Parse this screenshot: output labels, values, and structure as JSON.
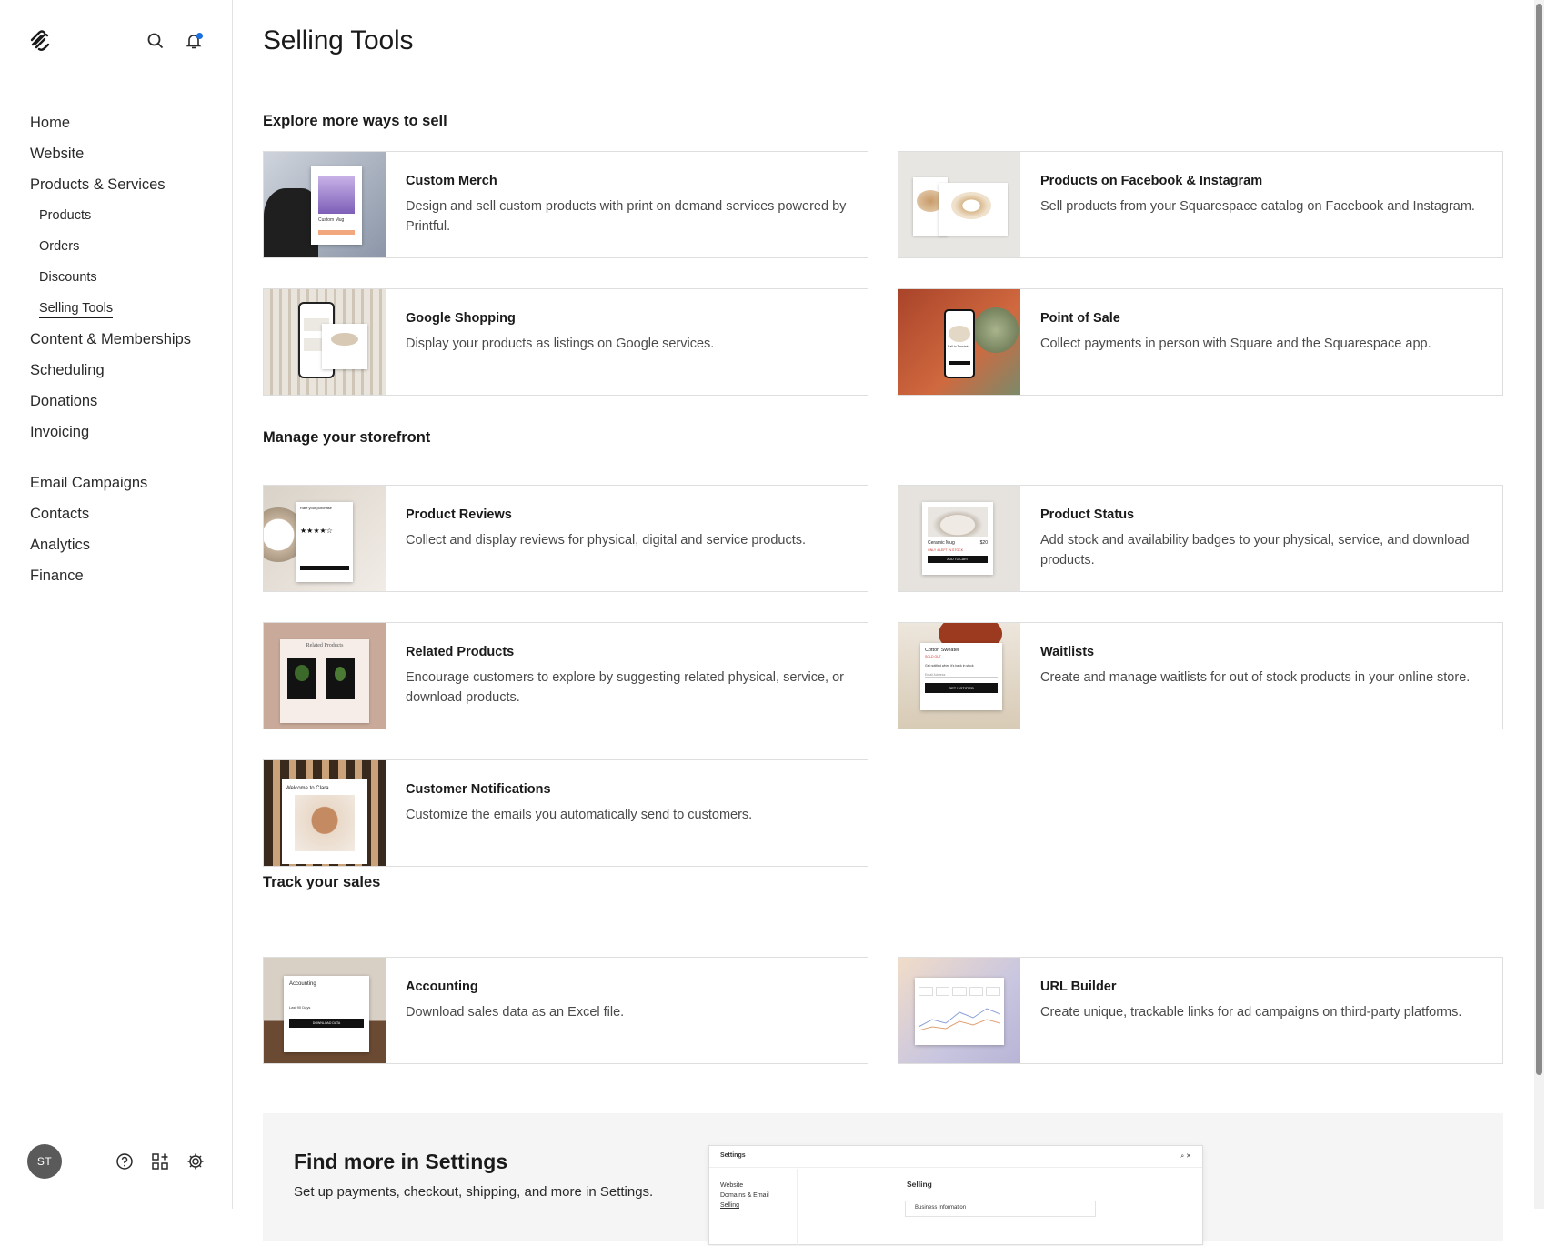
{
  "sidebar": {
    "nav": [
      {
        "label": "Home",
        "level": "main"
      },
      {
        "label": "Website",
        "level": "main"
      },
      {
        "label": "Products & Services",
        "level": "main"
      },
      {
        "label": "Products",
        "level": "sub"
      },
      {
        "label": "Orders",
        "level": "sub"
      },
      {
        "label": "Discounts",
        "level": "sub"
      },
      {
        "label": "Selling Tools",
        "level": "sub",
        "active": true
      },
      {
        "label": "Content & Memberships",
        "level": "main"
      },
      {
        "label": "Scheduling",
        "level": "main"
      },
      {
        "label": "Donations",
        "level": "main"
      },
      {
        "label": "Invoicing",
        "level": "main"
      },
      {
        "label": "Email Campaigns",
        "level": "main"
      },
      {
        "label": "Contacts",
        "level": "main"
      },
      {
        "label": "Analytics",
        "level": "main"
      },
      {
        "label": "Finance",
        "level": "main"
      }
    ],
    "avatar_initials": "ST",
    "icons": [
      "squarespace-logo",
      "search-icon",
      "bell-icon",
      "help-icon",
      "apps-icon",
      "settings-icon"
    ],
    "notification_color": "#1a6fe3"
  },
  "page": {
    "title": "Selling Tools"
  },
  "sections": [
    {
      "heading": "Explore more ways to sell",
      "cards": [
        {
          "title": "Custom Merch",
          "desc": "Design and sell custom products with print on demand services powered by Printful.",
          "thumb": "merch",
          "thumb_texts": [
            "Custom Mug"
          ]
        },
        {
          "title": "Products on Facebook & Instagram",
          "desc": "Sell products from your Squarespace catalog on Facebook and Instagram.",
          "thumb": "social",
          "thumb_texts": []
        },
        {
          "title": "Google Shopping",
          "desc": "Display your products as listings on Google services.",
          "thumb": "google",
          "thumb_texts": []
        },
        {
          "title": "Point of Sale",
          "desc": "Collect payments in person with Square and the Squarespace app.",
          "thumb": "pos",
          "thumb_texts": [
            "Ball in Tonstair"
          ]
        }
      ]
    },
    {
      "heading": "Manage your storefront",
      "cards": [
        {
          "title": "Product Reviews",
          "desc": "Collect and display reviews for physical, digital and service products.",
          "thumb": "reviews",
          "thumb_texts": [
            "Rate your purchase",
            "★★★★☆"
          ]
        },
        {
          "title": "Product Status",
          "desc": "Add stock and availability badges to your physical, service, and download products.",
          "thumb": "status",
          "thumb_texts": [
            "Ceramic Mug",
            "$20",
            "ONLY 4 LEFT IN STOCK",
            "ADD TO CART"
          ]
        },
        {
          "title": "Related Products",
          "desc": "Encourage customers to explore by suggesting related physical, service, or download products.",
          "thumb": "related",
          "thumb_texts": [
            "Related Products"
          ]
        },
        {
          "title": "Waitlists",
          "desc": "Create and manage waitlists for out of stock products in your online store.",
          "thumb": "waitlist",
          "thumb_texts": [
            "Cotton Sweater",
            "SOLD OUT",
            "Get notified when it's back in stock",
            "Email Address",
            "GET NOTIFIED"
          ]
        },
        {
          "title": "Customer Notifications",
          "desc": "Customize the emails you automatically send to customers.",
          "thumb": "notify",
          "thumb_texts": [
            "Welcome to Clara."
          ]
        }
      ]
    },
    {
      "heading": "Track your sales",
      "cards": [
        {
          "title": "Accounting",
          "desc": "Download sales data as an Excel file.",
          "thumb": "accounting",
          "thumb_texts": [
            "Accounting",
            "Last 90 Days",
            "DOWNLOAD DATA"
          ]
        },
        {
          "title": "URL Builder",
          "desc": "Create unique, trackable links for ad campaigns on third-party platforms.",
          "thumb": "url",
          "thumb_texts": []
        }
      ]
    }
  ],
  "banner": {
    "title": "Find more in Settings",
    "desc": "Set up payments, checkout, shipping, and more in Settings.",
    "preview": {
      "window_title": "Settings",
      "side_items": [
        "Website",
        "Domains & Email",
        "Selling"
      ],
      "heading": "Selling",
      "row": "Business Information"
    }
  }
}
